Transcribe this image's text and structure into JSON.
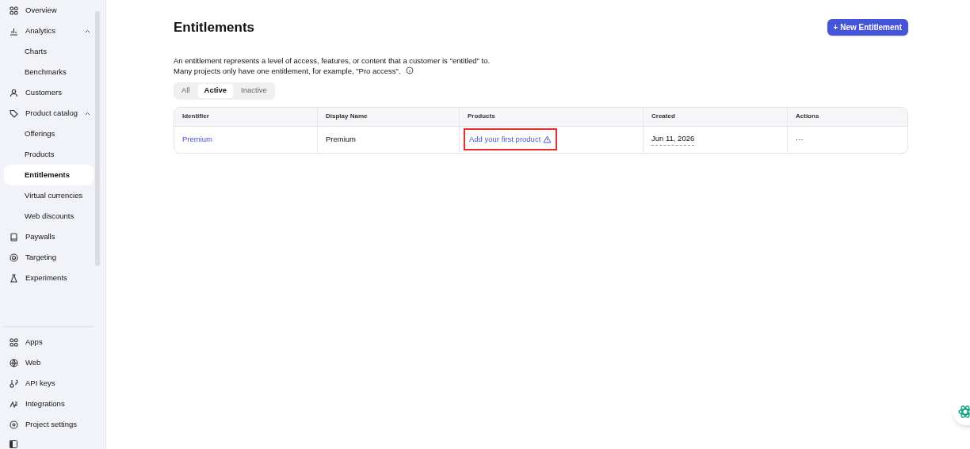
{
  "sidebar": {
    "items": [
      {
        "label": "Overview",
        "selected": false
      },
      {
        "label": "Analytics",
        "selected": false,
        "expanded": true,
        "children": [
          {
            "label": "Charts",
            "selected": false
          },
          {
            "label": "Benchmarks",
            "selected": false
          }
        ]
      },
      {
        "label": "Customers",
        "selected": false
      },
      {
        "label": "Product catalog",
        "selected": false,
        "expanded": true,
        "children": [
          {
            "label": "Offerings",
            "selected": false
          },
          {
            "label": "Products",
            "selected": false
          },
          {
            "label": "Entitlements",
            "selected": true
          },
          {
            "label": "Virtual currencies",
            "selected": false
          },
          {
            "label": "Web discounts",
            "selected": false
          }
        ]
      },
      {
        "label": "Paywalls",
        "selected": false
      },
      {
        "label": "Targeting",
        "selected": false
      },
      {
        "label": "Experiments",
        "selected": false
      }
    ],
    "footer_items": [
      {
        "label": "Apps"
      },
      {
        "label": "Web"
      },
      {
        "label": "API keys"
      },
      {
        "label": "Integrations"
      },
      {
        "label": "Project settings"
      }
    ]
  },
  "page": {
    "title": "Entitlements",
    "new_button": "+ New Entitlement",
    "description": [
      "An entitlement represents a level of access, features, or content that a customer is \"entitled\" to.",
      "Many projects only have one entitlement, for example, \"Pro access\"."
    ],
    "filters": [
      {
        "label": "All",
        "selected": false
      },
      {
        "label": "Active",
        "selected": true
      },
      {
        "label": "Inactive",
        "selected": false
      }
    ],
    "table": {
      "columns": [
        "Identifier",
        "Display Name",
        "Products",
        "Created",
        "Actions"
      ],
      "rows": [
        {
          "identifier": "Premium",
          "display_name": "Premium",
          "products": "Add your first product",
          "products_warning": true,
          "highlighted": true,
          "created": "Jun 11, 2026",
          "actions": "···"
        }
      ]
    }
  }
}
